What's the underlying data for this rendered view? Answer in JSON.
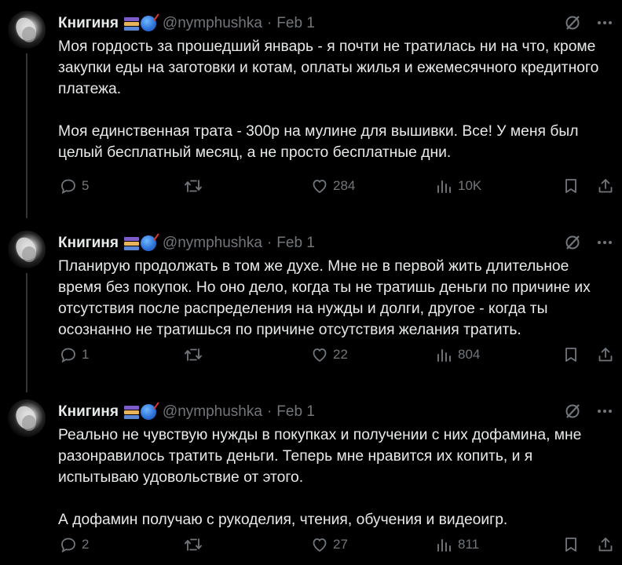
{
  "tweets": [
    {
      "author": "Книгиня",
      "handle": "@nymphushka",
      "separator": "·",
      "date": "Feb 1",
      "paragraphs": [
        "Моя гордость за прошедший январь - я почти не тратилась ни на что, кроме закупки еды на заготовки и котам, оплаты жилья и ежемесячного кредитного платежа.",
        "Моя единственная трата - 300р на мулине для вышивки. Все! У меня был целый бесплатный месяц, а не просто бесплатные дни."
      ],
      "replies": "5",
      "reposts": "",
      "likes": "284",
      "views": "10K"
    },
    {
      "author": "Книгиня",
      "handle": "@nymphushka",
      "separator": "·",
      "date": "Feb 1",
      "paragraphs": [
        "Планирую продолжать в том же духе. Мне не в первой жить длительное время без покупок. Но оно дело, когда ты не тратишь деньги по причине их отсутствия после распределения на нужды и долги, другое - когда ты осознанно не тратишься по причине отсутствия желания тратить."
      ],
      "replies": "1",
      "reposts": "",
      "likes": "22",
      "views": "804"
    },
    {
      "author": "Книгиня",
      "handle": "@nymphushka",
      "separator": "·",
      "date": "Feb 1",
      "paragraphs": [
        "Реально не чувствую нужды в покупках и получении с них дофамина, мне разонравилось тратить деньги. Теперь мне нравится их копить, и я испытываю удовольствие от этого.",
        "А дофамин получаю с рукоделия, чтения, обучения и видеоигр."
      ],
      "replies": "2",
      "reposts": "",
      "likes": "27",
      "views": "811"
    }
  ],
  "icons": {
    "author_emoji": [
      "books-icon",
      "yarn-ball-icon"
    ],
    "header": [
      "grok-icon",
      "more-icon"
    ],
    "actions": [
      "reply-icon",
      "repost-icon",
      "like-icon",
      "views-icon",
      "bookmark-icon",
      "share-icon"
    ]
  },
  "colors": {
    "background": "#000000",
    "text": "#e7e9ea",
    "secondary": "#71767b",
    "thread_line": "#333639"
  }
}
